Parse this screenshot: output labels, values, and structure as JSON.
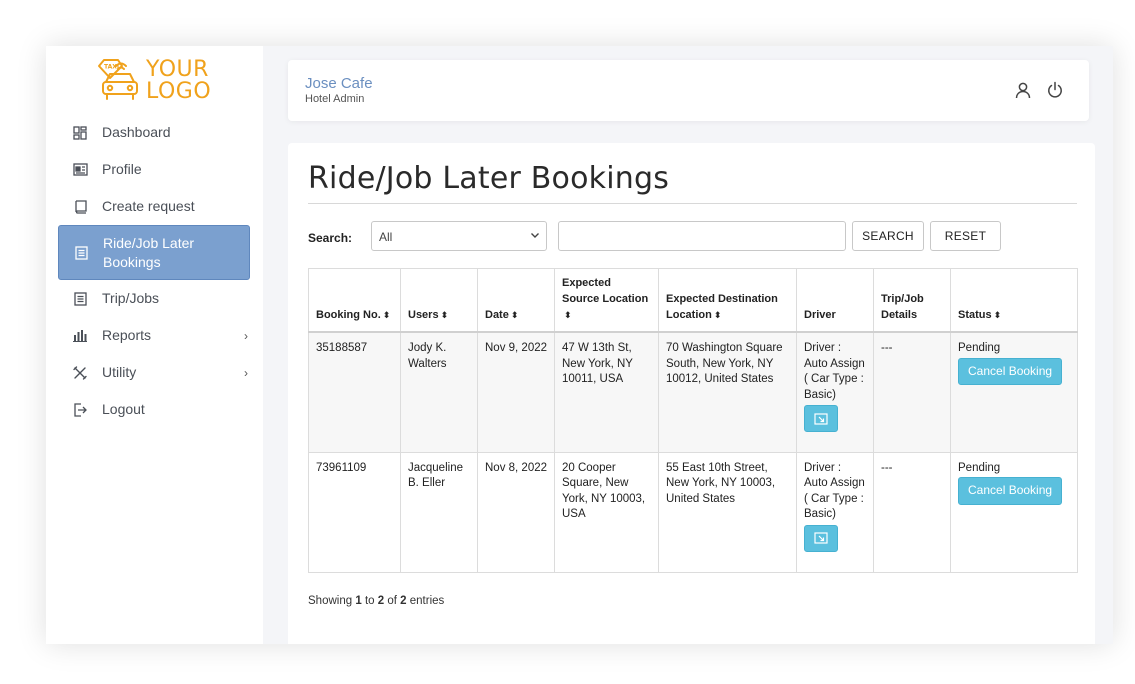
{
  "logo": {
    "line1": "YOUR",
    "line2": "LOGO",
    "badge": "TAXI"
  },
  "sidebar": {
    "items": [
      {
        "label": "Dashboard",
        "icon": "dashboard-icon"
      },
      {
        "label": "Profile",
        "icon": "profile-card-icon"
      },
      {
        "label": "Create request",
        "icon": "create-request-icon"
      },
      {
        "label": "Ride/Job Later Bookings",
        "icon": "bookings-list-icon",
        "active": true
      },
      {
        "label": "Trip/Jobs",
        "icon": "trips-list-icon"
      },
      {
        "label": "Reports",
        "icon": "bar-chart-icon",
        "chevron": "›"
      },
      {
        "label": "Utility",
        "icon": "tools-icon",
        "chevron": "›"
      },
      {
        "label": "Logout",
        "icon": "logout-icon"
      }
    ]
  },
  "header": {
    "hotel_name": "Jose Cafe",
    "role": "Hotel Admin"
  },
  "page": {
    "title": "Ride/Job Later Bookings"
  },
  "search": {
    "label": "Search:",
    "select_value": "All",
    "input_value": "",
    "search_label": "SEARCH",
    "reset_label": "RESET"
  },
  "table": {
    "columns": [
      {
        "label": "Booking No.",
        "sortable": true
      },
      {
        "label": "Users",
        "sortable": true
      },
      {
        "label": "Date",
        "sortable": true
      },
      {
        "label": "Expected Source Location",
        "sortable": true
      },
      {
        "label": "Expected Destination Location",
        "sortable": true
      },
      {
        "label": "Driver",
        "sortable": false
      },
      {
        "label": "Trip/Job Details",
        "sortable": false
      },
      {
        "label": "Status",
        "sortable": true
      }
    ],
    "rows": [
      {
        "booking_no": "35188587",
        "user": "Jody K. Walters",
        "date": "Nov 9, 2022",
        "source": "47 W 13th St, New York, NY 10011, USA",
        "destination": "70 Washington Square South, New York, NY 10012, United States",
        "driver": "Driver : Auto Assign ( Car Type : Basic)",
        "details": "---",
        "status": "Pending",
        "action": "Cancel Booking"
      },
      {
        "booking_no": "73961109",
        "user": "Jacqueline B. Eller",
        "date": "Nov 8, 2022",
        "source": "20 Cooper Square, New York, NY 10003, USA",
        "destination": "55 East 10th Street, New York, NY 10003, United States",
        "driver": "Driver : Auto Assign ( Car Type : Basic)",
        "details": "---",
        "status": "Pending",
        "action": "Cancel Booking"
      }
    ],
    "sort_glyph": "⬍"
  },
  "footer": {
    "prefix": "Showing",
    "from": "1",
    "to_word": "to",
    "to": "2",
    "of_word": "of",
    "total": "2",
    "suffix": "entries"
  },
  "colors": {
    "accent": "#7ba0cf",
    "info_button": "#5bc0de",
    "logo": "#f0a21c",
    "hotel_name": "#6b8fc0"
  }
}
